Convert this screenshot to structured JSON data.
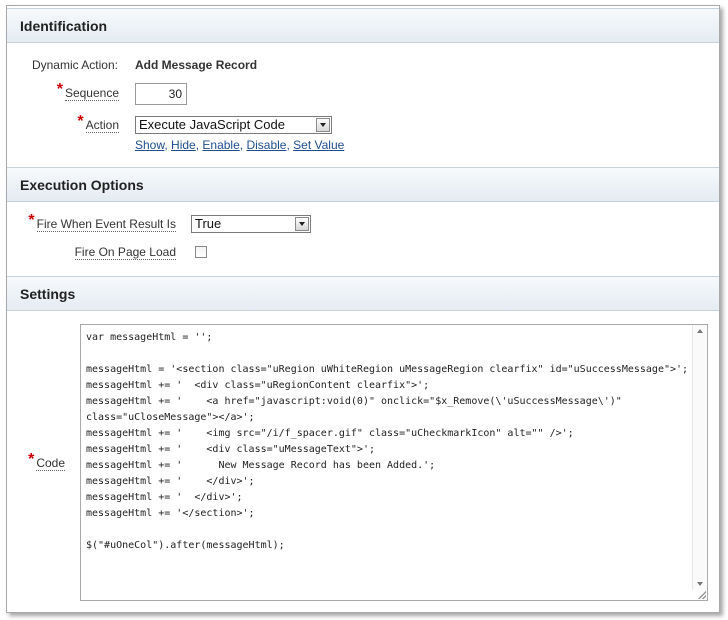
{
  "identification": {
    "header": "Identification",
    "dynamic_action_label": "Dynamic Action:",
    "dynamic_action_value": "Add Message Record",
    "sequence_label": "Sequence",
    "sequence_value": "30",
    "action_label": "Action",
    "action_value": "Execute JavaScript Code",
    "action_links": [
      "Show",
      "Hide",
      "Enable",
      "Disable",
      "Set Value"
    ]
  },
  "execution_options": {
    "header": "Execution Options",
    "fire_when_label": "Fire When Event Result Is",
    "fire_when_value": "True",
    "fire_on_load_label": "Fire On Page Load",
    "fire_on_load_checked": false
  },
  "settings": {
    "header": "Settings",
    "code_label": "Code",
    "code_value": "var messageHtml = '';\n\nmessageHtml = '<section class=\"uRegion uWhiteRegion uMessageRegion clearfix\" id=\"uSuccessMessage\">';\nmessageHtml += '  <div class=\"uRegionContent clearfix\">';\nmessageHtml += '    <a href=\"javascript:void(0)\" onclick=\"$x_Remove(\\'uSuccessMessage\\')\" class=\"uCloseMessage\"></a>';\nmessageHtml += '    <img src=\"/i/f_spacer.gif\" class=\"uCheckmarkIcon\" alt=\"\" />';\nmessageHtml += '    <div class=\"uMessageText\">';\nmessageHtml += '      New Message Record has been Added.';\nmessageHtml += '    </div>';\nmessageHtml += '  </div>';\nmessageHtml += '</section>';\n\n$(\"#uOneCol\").after(messageHtml);"
  },
  "colors": {
    "required_star": "#cc0000",
    "link": "#1f4f8f",
    "header_bg": "#e4ebf2"
  }
}
